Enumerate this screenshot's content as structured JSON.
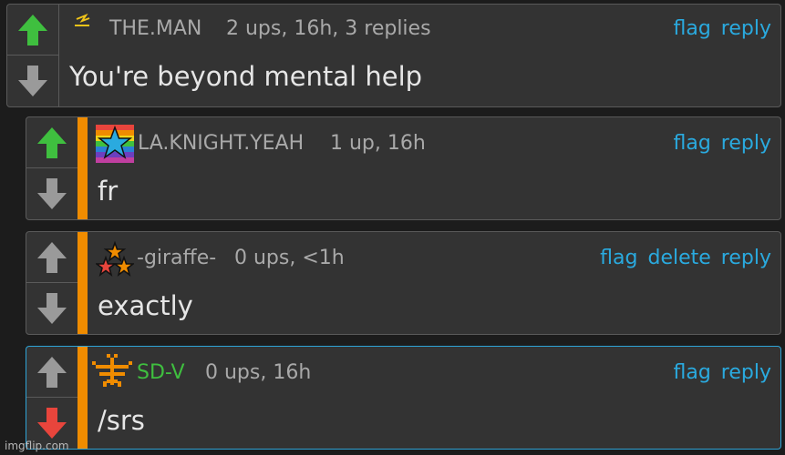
{
  "colors": {
    "upvoted": "#3fbf3f",
    "downvoted": "#e8453c",
    "neutral": "#9a9a9a",
    "accent": "#2aaadf",
    "reply_stripe": "#f08c00"
  },
  "comments": [
    {
      "username": "THE.MAN",
      "meta": "2 ups, 16h, 3 replies",
      "text": "You're beyond mental help",
      "actions": [
        "flag",
        "reply"
      ],
      "vote": "up",
      "avatar": "lightning-icon"
    },
    {
      "username": "LA.KNIGHT.YEAH",
      "meta": "1 up, 16h",
      "text": "fr",
      "actions": [
        "flag",
        "reply"
      ],
      "vote": "up",
      "avatar": "rainbow-star-icon"
    },
    {
      "username": "-giraffe-",
      "meta": "0 ups, <1h",
      "text": "exactly",
      "actions": [
        "flag",
        "delete",
        "reply"
      ],
      "vote": "none",
      "avatar": "three-stars-icon"
    },
    {
      "username": "SD-V",
      "meta": "0 ups, 16h",
      "text": "/srs",
      "actions": [
        "flag",
        "reply"
      ],
      "vote": "down",
      "avatar": "pixel-figure-icon"
    }
  ],
  "watermark": "imgflip.com"
}
